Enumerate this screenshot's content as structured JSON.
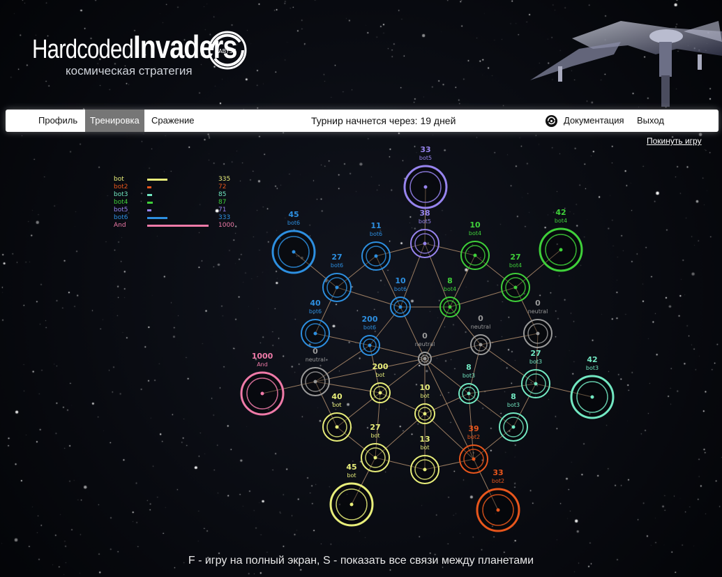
{
  "logo": {
    "word1": "Hardcoded",
    "word2": "Invaders",
    "subtitle": "космическая стратегия",
    "badge": "ABYSS"
  },
  "nav": {
    "profile": "Профиль",
    "training": "Тренировка",
    "battle": "Сражение",
    "tournament": "Турнир начнется через: 19 дней",
    "docs": "Документация",
    "exit": "Выход"
  },
  "leave_game": "Покинуть игру",
  "colors": {
    "bot": "#e8ee7a",
    "bot2": "#e8561c",
    "bot3": "#72e8c2",
    "bot4": "#3fd03a",
    "bot5": "#9784ee",
    "bot6": "#2d8fe0",
    "And": "#ef7aa8",
    "neutral": "#9a9a9a",
    "edge": "#c9a07a"
  },
  "legend": [
    {
      "name": "bot",
      "value": "335",
      "player": "bot",
      "fraction": 0.335
    },
    {
      "name": "bot2",
      "value": "72",
      "player": "bot2",
      "fraction": 0.072
    },
    {
      "name": "bot3",
      "value": "85",
      "player": "bot3",
      "fraction": 0.085
    },
    {
      "name": "bot4",
      "value": "87",
      "player": "bot4",
      "fraction": 0.087
    },
    {
      "name": "bot5",
      "value": "71",
      "player": "bot5",
      "fraction": 0.071
    },
    {
      "name": "bot6",
      "value": "333",
      "player": "bot6",
      "fraction": 0.333
    },
    {
      "name": "And",
      "value": "1000",
      "player": "And",
      "fraction": 1.0
    }
  ],
  "planets": [
    {
      "id": "p1",
      "count": "33",
      "owner": "bot5",
      "player": "bot5",
      "size": "large"
    },
    {
      "id": "p2",
      "count": "38",
      "owner": "bot5",
      "player": "bot5",
      "size": "small"
    },
    {
      "id": "p3",
      "count": "11",
      "owner": "bot6",
      "player": "bot6",
      "size": "small"
    },
    {
      "id": "p4",
      "count": "10",
      "owner": "bot4",
      "player": "bot4",
      "size": "small"
    },
    {
      "id": "p5",
      "count": "45",
      "owner": "bot6",
      "player": "bot6",
      "size": "large"
    },
    {
      "id": "p6",
      "count": "42",
      "owner": "bot4",
      "player": "bot4",
      "size": "large"
    },
    {
      "id": "p7",
      "count": "27",
      "owner": "bot6",
      "player": "bot6",
      "size": "medium"
    },
    {
      "id": "p8",
      "count": "27",
      "owner": "bot4",
      "player": "bot4",
      "size": "medium"
    },
    {
      "id": "p9",
      "count": "10",
      "owner": "bot6",
      "player": "bot6",
      "size": "xsmall"
    },
    {
      "id": "p10",
      "count": "8",
      "owner": "bot4",
      "player": "bot4",
      "size": "xsmall"
    },
    {
      "id": "p11",
      "count": "40",
      "owner": "bot6",
      "player": "bot6",
      "size": "small"
    },
    {
      "id": "p12",
      "count": "0",
      "owner": "neutral",
      "player": "neutral",
      "size": "small"
    },
    {
      "id": "p13",
      "count": "200",
      "owner": "bot6",
      "player": "bot6",
      "size": "xsmall"
    },
    {
      "id": "p14",
      "count": "0",
      "owner": "neutral",
      "player": "neutral",
      "size": "xsmall"
    },
    {
      "id": "p15",
      "count": "0",
      "owner": "neutral",
      "player": "neutral",
      "size": "tiny"
    },
    {
      "id": "p16",
      "count": "1000",
      "owner": "And",
      "player": "And",
      "size": "large"
    },
    {
      "id": "p17",
      "count": "0",
      "owner": "neutral",
      "player": "neutral",
      "size": "medium"
    },
    {
      "id": "p18",
      "count": "27",
      "owner": "bot3",
      "player": "bot3",
      "size": "medium"
    },
    {
      "id": "p19",
      "count": "42",
      "owner": "bot3",
      "player": "bot3",
      "size": "large"
    },
    {
      "id": "p20",
      "count": "200",
      "owner": "bot",
      "player": "bot",
      "size": "xsmall"
    },
    {
      "id": "p21",
      "count": "8",
      "owner": "bot3",
      "player": "bot3",
      "size": "xsmall"
    },
    {
      "id": "p22",
      "count": "10",
      "owner": "bot",
      "player": "bot",
      "size": "xsmall"
    },
    {
      "id": "p23",
      "count": "40",
      "owner": "bot",
      "player": "bot",
      "size": "small"
    },
    {
      "id": "p24",
      "count": "8",
      "owner": "bot3",
      "player": "bot3",
      "size": "small"
    },
    {
      "id": "p25",
      "count": "27",
      "owner": "bot",
      "player": "bot",
      "size": "medium"
    },
    {
      "id": "p26",
      "count": "39",
      "owner": "bot2",
      "player": "bot2",
      "size": "medium"
    },
    {
      "id": "p27",
      "count": "13",
      "owner": "bot",
      "player": "bot",
      "size": "small"
    },
    {
      "id": "p28",
      "count": "45",
      "owner": "bot",
      "player": "bot",
      "size": "large"
    },
    {
      "id": "p29",
      "count": "33",
      "owner": "bot2",
      "player": "bot2",
      "size": "large"
    }
  ],
  "links": [
    [
      "p1",
      "p2"
    ],
    [
      "p2",
      "p3"
    ],
    [
      "p2",
      "p4"
    ],
    [
      "p2",
      "p9"
    ],
    [
      "p2",
      "p10"
    ],
    [
      "p3",
      "p7"
    ],
    [
      "p3",
      "p9"
    ],
    [
      "p4",
      "p8"
    ],
    [
      "p4",
      "p10"
    ],
    [
      "p5",
      "p7"
    ],
    [
      "p6",
      "p8"
    ],
    [
      "p7",
      "p9"
    ],
    [
      "p7",
      "p11"
    ],
    [
      "p8",
      "p10"
    ],
    [
      "p8",
      "p12"
    ],
    [
      "p9",
      "p10"
    ],
    [
      "p9",
      "p13"
    ],
    [
      "p9",
      "p15"
    ],
    [
      "p10",
      "p14"
    ],
    [
      "p10",
      "p15"
    ],
    [
      "p11",
      "p13"
    ],
    [
      "p12",
      "p14"
    ],
    [
      "p12",
      "p18"
    ],
    [
      "p13",
      "p15"
    ],
    [
      "p13",
      "p17"
    ],
    [
      "p13",
      "p20"
    ],
    [
      "p14",
      "p15"
    ],
    [
      "p14",
      "p18"
    ],
    [
      "p14",
      "p21"
    ],
    [
      "p15",
      "p17"
    ],
    [
      "p15",
      "p20"
    ],
    [
      "p15",
      "p21"
    ],
    [
      "p15",
      "p22"
    ],
    [
      "p15",
      "p26"
    ],
    [
      "p16",
      "p17"
    ],
    [
      "p17",
      "p20"
    ],
    [
      "p17",
      "p23"
    ],
    [
      "p18",
      "p19"
    ],
    [
      "p18",
      "p21"
    ],
    [
      "p18",
      "p24"
    ],
    [
      "p20",
      "p22"
    ],
    [
      "p20",
      "p23"
    ],
    [
      "p20",
      "p25"
    ],
    [
      "p21",
      "p22"
    ],
    [
      "p21",
      "p24"
    ],
    [
      "p21",
      "p26"
    ],
    [
      "p22",
      "p25"
    ],
    [
      "p22",
      "p27"
    ],
    [
      "p22",
      "p26"
    ],
    [
      "p23",
      "p25"
    ],
    [
      "p25",
      "p27"
    ],
    [
      "p25",
      "p28"
    ],
    [
      "p24",
      "p26"
    ],
    [
      "p26",
      "p27"
    ],
    [
      "p26",
      "p29"
    ]
  ],
  "footer": "F - игру на полный экран, S - показать все связи между планетами"
}
